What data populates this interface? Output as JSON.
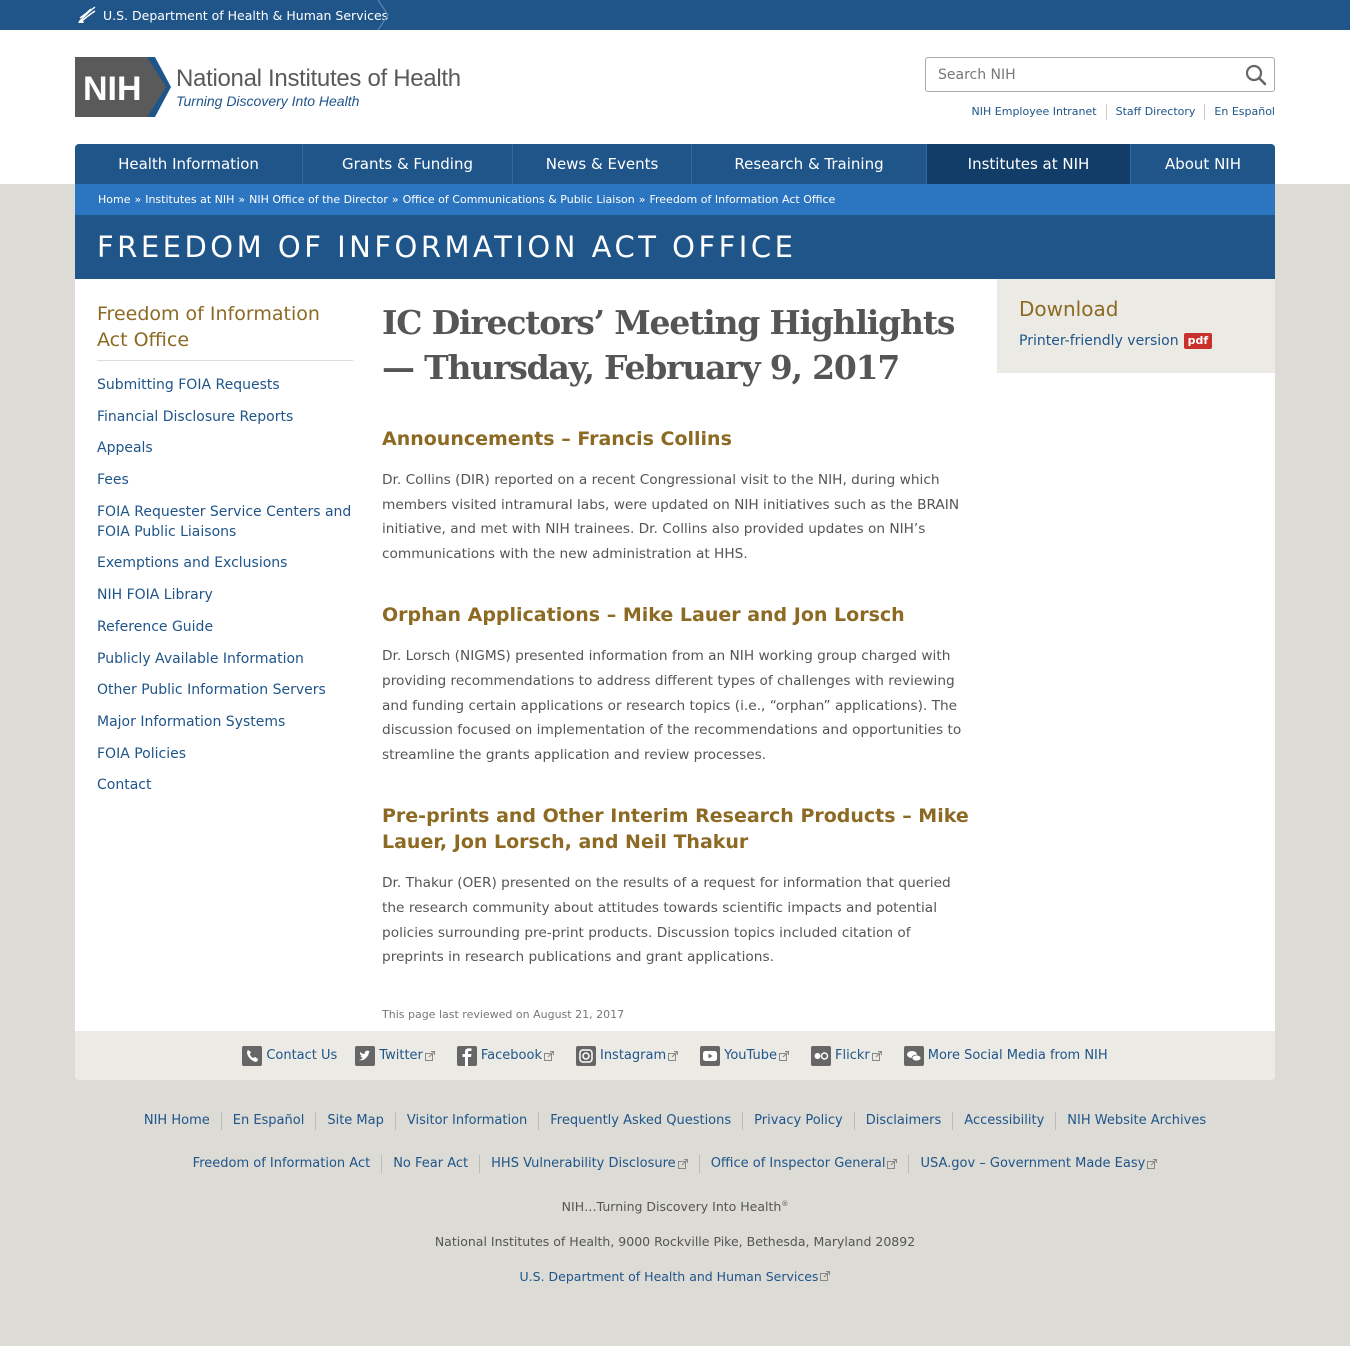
{
  "hhs_bar": {
    "label": "U.S. Department of Health & Human Services"
  },
  "header": {
    "logo_mark": "NIH",
    "logo_title": "National Institutes of Health",
    "logo_tagline": "Turning Discovery Into Health",
    "search_placeholder": "Search NIH",
    "util_links": [
      "NIH Employee Intranet",
      "Staff Directory",
      "En Español"
    ]
  },
  "nav": {
    "items": [
      {
        "label": "Health Information",
        "active": false
      },
      {
        "label": "Grants & Funding",
        "active": false
      },
      {
        "label": "News & Events",
        "active": false
      },
      {
        "label": "Research & Training",
        "active": false
      },
      {
        "label": "Institutes at NIH",
        "active": true
      },
      {
        "label": "About NIH",
        "active": false
      }
    ]
  },
  "breadcrumb": [
    "Home",
    "Institutes at NIH",
    "NIH Office of the Director",
    "Office of Communications & Public Liaison",
    "Freedom of Information Act Office"
  ],
  "banner_title": "FREEDOM OF INFORMATION ACT OFFICE",
  "sidebar": {
    "title": "Freedom of Information Act Office",
    "items": [
      "Submitting FOIA Requests",
      "Financial Disclosure Reports",
      "Appeals",
      "Fees",
      "FOIA Requester Service Centers and FOIA Public Liaisons",
      "Exemptions and Exclusions",
      "NIH FOIA Library",
      "Reference Guide",
      "Publicly Available Information",
      "Other Public Information Servers",
      "Major Information Systems",
      "FOIA Policies",
      "Contact"
    ]
  },
  "article": {
    "title": "IC Directors’ Meeting Highlights — Thursday, February 9, 2017",
    "sections": [
      {
        "heading": "Announcements – Francis Collins",
        "body": "Dr. Collins (DIR) reported on a recent Congressional visit to the NIH, during which members visited intramural labs, were updated on NIH initiatives such as the BRAIN initiative, and met with NIH trainees. Dr. Collins also provided updates on NIH’s communications with the new administration at HHS."
      },
      {
        "heading": "Orphan Applications – Mike Lauer and Jon Lorsch",
        "body": "Dr. Lorsch (NIGMS) presented information from an NIH working group charged with providing recommendations to address different types of challenges with reviewing and funding certain applications or research topics (i.e., “orphan” applications). The discussion focused on implementation of the recommendations and opportunities to streamline the grants application and review processes."
      },
      {
        "heading": "Pre-prints and Other Interim Research Products – Mike Lauer, Jon Lorsch, and Neil Thakur",
        "body": "Dr. Thakur (OER) presented on the results of a request for information that queried the research community about attitudes towards scientific impacts and potential policies surrounding pre-print products. Discussion topics included citation of preprints in research publications and grant applications."
      }
    ],
    "reviewed": "This page last reviewed on August 21, 2017"
  },
  "download": {
    "title": "Download",
    "link": "Printer-friendly version",
    "badge": "pdf"
  },
  "social": {
    "items": [
      {
        "label": "Contact Us",
        "icon": "phone-icon",
        "external": false
      },
      {
        "label": "Twitter",
        "icon": "twitter-icon",
        "external": true
      },
      {
        "label": "Facebook",
        "icon": "facebook-icon",
        "external": true
      },
      {
        "label": "Instagram",
        "icon": "instagram-icon",
        "external": true
      },
      {
        "label": "YouTube",
        "icon": "youtube-icon",
        "external": true
      },
      {
        "label": "Flickr",
        "icon": "flickr-icon",
        "external": true
      },
      {
        "label": "More Social Media from NIH",
        "icon": "chat-bubbles-icon",
        "external": false
      }
    ]
  },
  "footer": {
    "links_row1": [
      "NIH Home",
      "En Español",
      "Site Map",
      "Visitor Information",
      "Frequently Asked Questions",
      "Privacy Policy",
      "Disclaimers",
      "Accessibility",
      "NIH Website Archives"
    ],
    "links_row2": [
      {
        "label": "Freedom of Information Act",
        "external": false
      },
      {
        "label": "No Fear Act",
        "external": false
      },
      {
        "label": "HHS Vulnerability Disclosure",
        "external": true
      },
      {
        "label": "Office of Inspector General",
        "external": true
      },
      {
        "label": "USA.gov – Government Made Easy",
        "external": true
      }
    ],
    "tagline": "NIH…Turning Discovery Into Health",
    "tagline_mark": "®",
    "address": "National Institutes of Health, 9000 Rockville Pike, Bethesda, Maryland 20892",
    "hhs_link": "U.S. Department of Health and Human Services"
  },
  "colors": {
    "primary_blue": "#20558a",
    "active_nav": "#133d69",
    "crumb_blue": "#2b75c1",
    "gold": "#8d6a24",
    "pdf_red": "#c9302c"
  }
}
